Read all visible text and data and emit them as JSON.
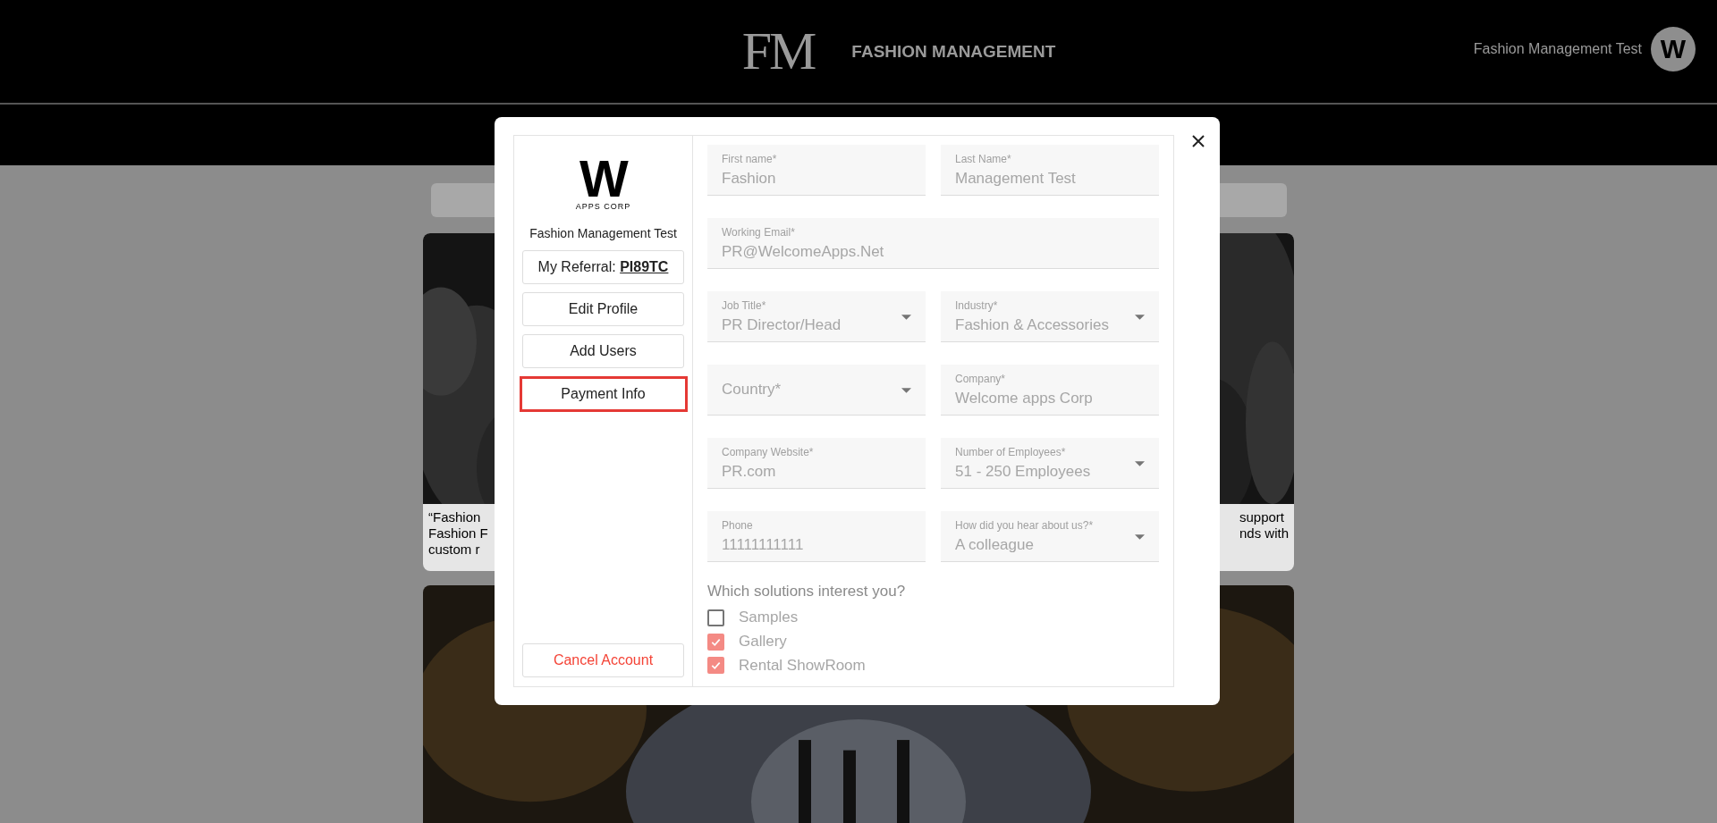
{
  "header": {
    "logo": "FM",
    "title": "FASHION MANAGEMENT",
    "user_name": "Fashion Management Test",
    "avatar_letter": "W"
  },
  "background_card": {
    "kind": "picture",
    "caption_left": [
      "“Fashion",
      "Fashion F",
      "custom r"
    ],
    "caption_right": [
      "support",
      "nds with"
    ]
  },
  "modal": {
    "sidebar": {
      "logo_letter": "W",
      "logo_subtitle": "APPS CORP",
      "name": "Fashion Management Test",
      "items": [
        {
          "label": "My Referral: **PI89TC**",
          "selected": false
        },
        {
          "label": "Edit Profile",
          "selected": false
        },
        {
          "label": "Add Users",
          "selected": false
        },
        {
          "label": "Payment Info",
          "selected": true
        }
      ],
      "cancel": "Cancel Account"
    },
    "form": {
      "rows": [
        [
          {
            "kind": "text",
            "label": "First name*",
            "value": "Fashion"
          },
          {
            "kind": "text",
            "label": "Last Name*",
            "value": "Management Test"
          }
        ],
        [
          {
            "kind": "text",
            "label": "Working Email*",
            "value": "PR@WelcomeApps.Net"
          }
        ],
        [
          {
            "kind": "select",
            "label": "Job Title*",
            "value": "PR Director/Head"
          },
          {
            "kind": "select",
            "label": "Industry*",
            "value": "Fashion & Accessories"
          }
        ],
        [
          {
            "kind": "select",
            "placeholder": "Country*"
          },
          {
            "kind": "text",
            "label": "Company*",
            "value": "Welcome apps Corp"
          }
        ],
        [
          {
            "kind": "text",
            "label": "Company Website*",
            "value": "PR.com"
          },
          {
            "kind": "select",
            "label": "Number of Employees*",
            "value": "51 - 250 Employees"
          }
        ],
        [
          {
            "kind": "text",
            "label": "Phone",
            "value": "11111111111"
          },
          {
            "kind": "select",
            "label": "How did you hear about us?*",
            "value": "A colleague"
          }
        ]
      ],
      "question": "Which solutions interest you?",
      "options": [
        {
          "label": "Samples",
          "checked": false
        },
        {
          "label": "Gallery",
          "checked": true
        },
        {
          "label": "Rental ShowRoom",
          "checked": true
        }
      ]
    }
  }
}
